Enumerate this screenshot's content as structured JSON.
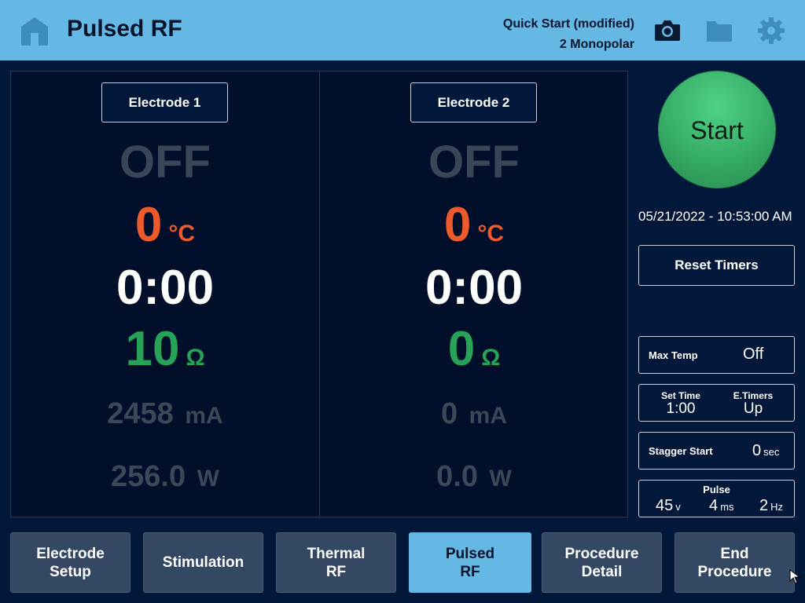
{
  "header": {
    "title": "Pulsed RF",
    "preset_name": "Quick Start (modified)",
    "preset_mode": "2 Monopolar",
    "icons": [
      "home-icon",
      "camera-icon",
      "folder-icon",
      "gear-icon"
    ]
  },
  "electrodes": [
    {
      "label": "Electrode 1",
      "state": "OFF",
      "temperature": "0",
      "temperature_unit": "°C",
      "timer": "0:00",
      "impedance": "10",
      "impedance_unit": "Ω",
      "current": "2458",
      "current_unit": "mA",
      "power": "256.0",
      "power_unit": "W"
    },
    {
      "label": "Electrode 2",
      "state": "OFF",
      "temperature": "0",
      "temperature_unit": "°C",
      "timer": "0:00",
      "impedance": "0",
      "impedance_unit": "Ω",
      "current": "0",
      "current_unit": "mA",
      "power": "0.0",
      "power_unit": "W"
    }
  ],
  "sidebar": {
    "start_label": "Start",
    "datetime": "05/21/2022 - 10:53:00 AM",
    "reset_label": "Reset Timers",
    "max_temp": {
      "label": "Max Temp",
      "value": "Off"
    },
    "set_time": {
      "label": "Set Time",
      "value": "1:00"
    },
    "e_timers": {
      "label": "E.Timers",
      "value": "Up"
    },
    "stagger": {
      "label": "Stagger Start",
      "value": "0",
      "unit": "sec"
    },
    "pulse": {
      "label": "Pulse",
      "voltage": "45",
      "voltage_unit": "v",
      "width": "4",
      "width_unit": "ms",
      "rate": "2",
      "rate_unit": "Hz"
    }
  },
  "nav": {
    "electrode_setup": [
      "Electrode",
      "Setup"
    ],
    "stimulation": "Stimulation",
    "thermal_rf": [
      "Thermal",
      "RF"
    ],
    "pulsed_rf": [
      "Pulsed",
      "RF"
    ],
    "procedure_detail": [
      "Procedure",
      "Detail"
    ],
    "end_procedure": [
      "End",
      "Procedure"
    ]
  },
  "colors": {
    "header_bg": "#65b8e4",
    "page_bg": "#02183a",
    "temperature": "#ee5a2c",
    "impedance": "#27a257",
    "start_button": "#34a862",
    "inactive_text": "#3a4557"
  }
}
